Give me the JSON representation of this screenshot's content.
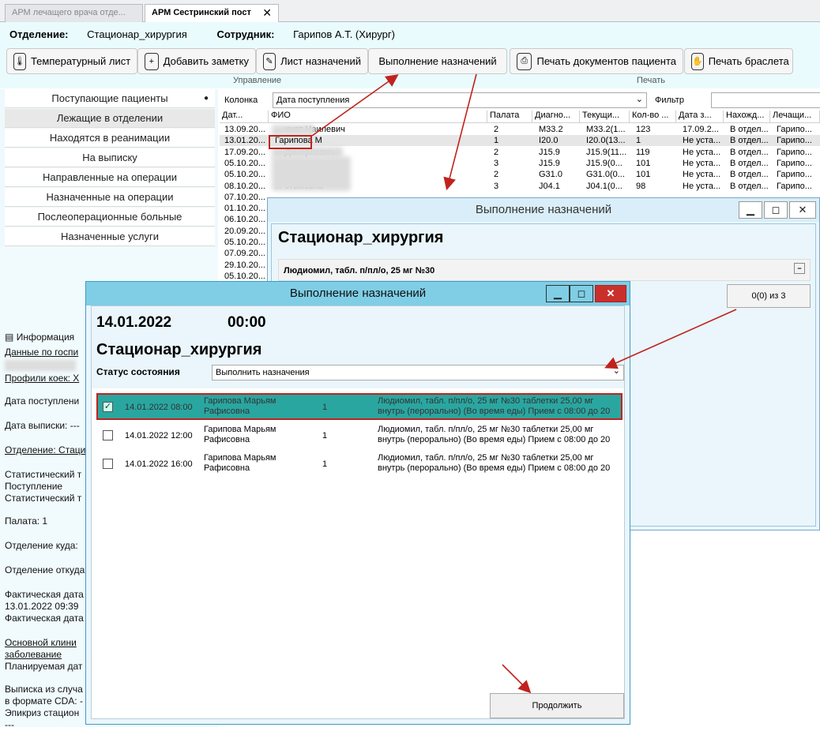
{
  "tabs": [
    {
      "label": "АРМ лечащего врача отде..."
    },
    {
      "label": "АРМ Сестринский пост"
    }
  ],
  "header": {
    "dept_label": "Отделение:",
    "dept_value": "Стационар_хирургия",
    "staff_label": "Сотрудник:",
    "staff_value": "Гарипов А.Т. (Хирург)"
  },
  "toolbar": {
    "temp": "Температурный лист",
    "note": "Добавить заметку",
    "orders": "Лист назначений",
    "exec": "Выполнение назначений",
    "print_docs": "Печать документов пациента",
    "bracelet": "Печать браслета",
    "group_manage": "Управление",
    "group_print": "Печать"
  },
  "nav": [
    "Поступающие пациенты",
    "Лежащие в отделении",
    "Находятся в реанимации",
    "На выписку",
    "Направленные на операции",
    "Назначенные на операции",
    "Послеоперационные больные",
    "Назначенные услуги"
  ],
  "filter": {
    "column_label": "Колонка",
    "column_value": "Дата поступления",
    "filter_label": "Фильтр"
  },
  "table": {
    "headers": [
      "Дат...",
      "ФИО",
      "Палата",
      "Диагно...",
      "Текущи...",
      "Кол-во ...",
      "Дата з...",
      "Нахожд...",
      "Лечащи..."
    ],
    "rows": [
      [
        "13.09.20...",
        "... инат Наилевич",
        "2",
        "M33.2",
        "M33.2(1...",
        "123",
        "17.09.2...",
        "В отдел...",
        "Гарипо..."
      ],
      [
        "13.01.20...",
        "Гарипова М",
        "1",
        "I20.0",
        "I20.0(13...",
        "1",
        "Не уста...",
        "В отдел...",
        "Гарипо..."
      ],
      [
        "17.09.20...",
        "... Дмитриевич",
        "2",
        "J15.9",
        "J15.9(11...",
        "119",
        "Не уста...",
        "В отдел...",
        "Гарипо..."
      ],
      [
        "05.10.20...",
        "... ргеевна",
        "3",
        "J15.9",
        "J15.9(0...",
        "101",
        "Не уста...",
        "В отдел...",
        "Гарипо..."
      ],
      [
        "05.10.20...",
        "... Рафисовна",
        "2",
        "G31.0",
        "G31.0(0...",
        "101",
        "Не уста...",
        "В отдел...",
        "Гарипо..."
      ],
      [
        "08.10.20...",
        "... отёмовна",
        "3",
        "J04.1",
        "J04.1(0...",
        "98",
        "Не уста...",
        "В отдел...",
        "Гарипо..."
      ],
      [
        "07.10.20...",
        "",
        "",
        "",
        "",
        "",
        "",
        "",
        ""
      ],
      [
        "01.10.20...",
        "",
        "",
        "",
        "",
        "",
        "",
        "",
        ""
      ],
      [
        "06.10.20...",
        "",
        "",
        "",
        "",
        "",
        "",
        "",
        ""
      ],
      [
        "20.09.20...",
        "",
        "",
        "",
        "",
        "",
        "",
        "",
        ""
      ],
      [
        "05.10.20...",
        "",
        "",
        "",
        "",
        "",
        "",
        "",
        ""
      ],
      [
        "07.09.20...",
        "",
        "",
        "",
        "",
        "",
        "",
        "",
        ""
      ],
      [
        "29.10.20...",
        "",
        "",
        "",
        "",
        "",
        "",
        "",
        ""
      ],
      [
        "05.10.20...",
        "",
        "",
        "",
        "",
        "",
        "",
        "",
        ""
      ]
    ]
  },
  "info": {
    "title": "Информация",
    "lines": [
      "Данные по госпи",
      "Профили коек: Х",
      "Дата поступлени",
      "Дата выписки: ---",
      "Отделение: Стаци",
      "Статистический т",
      "Поступление",
      "Статистический т",
      "Палата: 1",
      "Отделение куда: ",
      "Отделение откуда",
      "Фактическая дата",
      "13.01.2022 09:39",
      "Фактическая дата",
      "Основной клини",
      "заболевание",
      "Планируемая дат",
      "Выписка из случа",
      "в формате CDA: -",
      "Эпикриз стацион",
      "---"
    ]
  },
  "back_window": {
    "title": "Выполнение назначений",
    "dept": "Стационар_хирургия",
    "drug": "Людиомил, табл. п/пл/о, 25 мг №30",
    "counter": "0(0) из 3"
  },
  "front_window": {
    "title": "Выполнение назначений",
    "date": "14.01.2022",
    "time": "00:00",
    "dept": "Стационар_хирургия",
    "status_label": "Статус состояния",
    "status_value": "Выполнить назначения",
    "rows": [
      {
        "dt": "14.01.2022 08:00",
        "name1": "Гарипова Марьям",
        "name2": "Рафисовна",
        "qty": "1",
        "d1": "Людиомил, табл. п/пл/о, 25 мг №30 таблетки 25,00 мг",
        "d2": "внутрь (перорально) (Во время еды)   Прием с 08:00 до 20",
        "checked": true
      },
      {
        "dt": "14.01.2022 12:00",
        "name1": "Гарипова Марьям",
        "name2": "Рафисовна",
        "qty": "1",
        "d1": "Людиомил, табл. п/пл/о, 25 мг №30 таблетки 25,00 мг",
        "d2": "внутрь (перорально) (Во время еды)   Прием с 08:00 до 20",
        "checked": false
      },
      {
        "dt": "14.01.2022 16:00",
        "name1": "Гарипова Марьям",
        "name2": "Рафисовна",
        "qty": "1",
        "d1": "Людиомил, табл. п/пл/о, 25 мг №30 таблетки 25,00 мг",
        "d2": "внутрь (перорально) (Во время еды)   Прием с 08:00 до 20",
        "checked": false
      }
    ],
    "continue": "Продолжить"
  }
}
